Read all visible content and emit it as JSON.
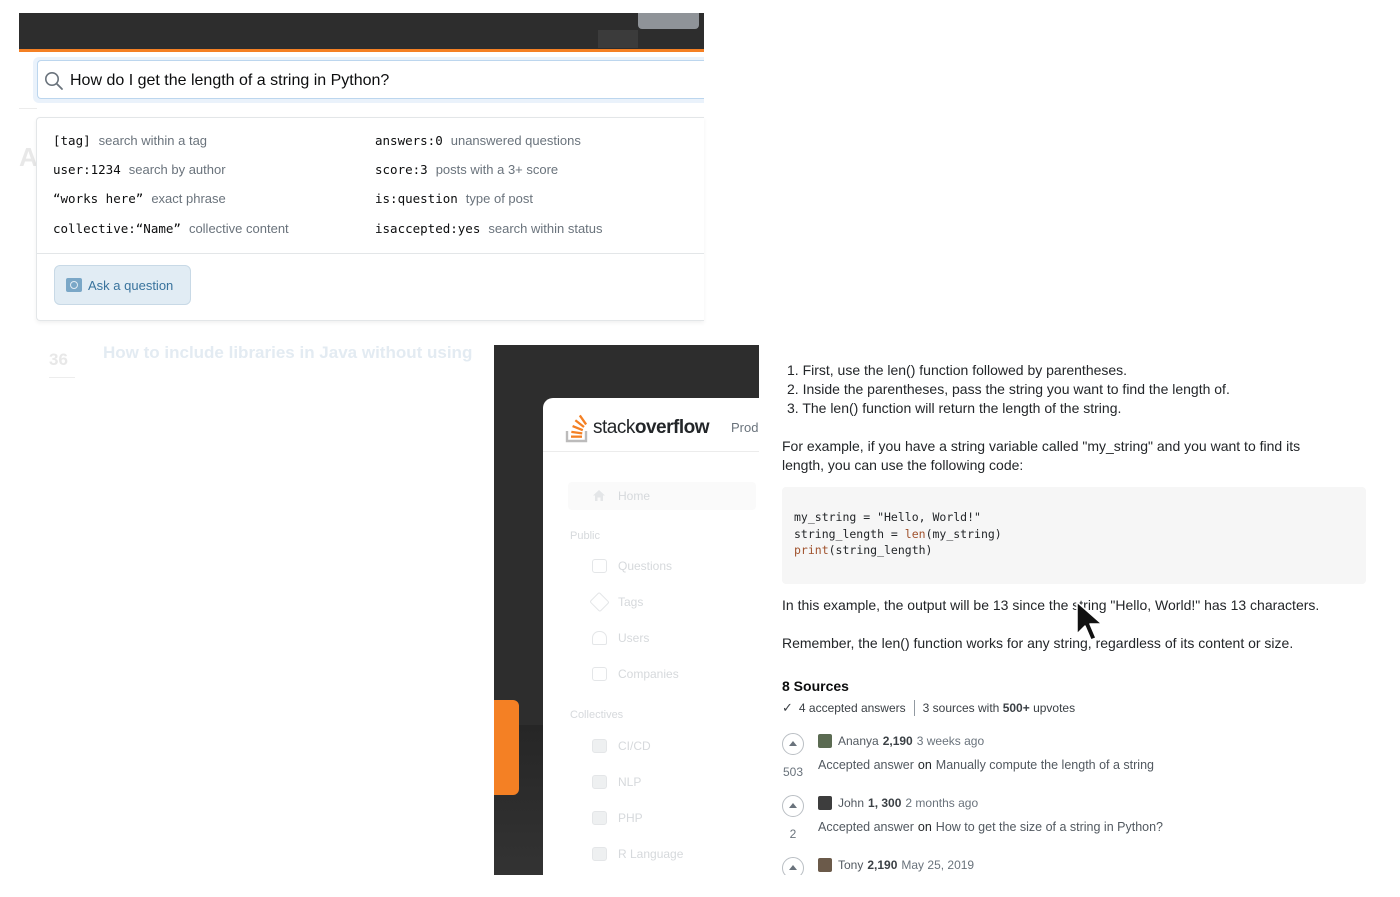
{
  "search": {
    "query": "How do I get the length of a string in Python?",
    "hints_left": [
      {
        "code": "[tag]",
        "desc": "search within a tag"
      },
      {
        "code": "user:1234",
        "desc": "search by author"
      },
      {
        "code": "“works here”",
        "desc": "exact phrase"
      },
      {
        "code": "collective:“Name”",
        "desc": "collective content"
      }
    ],
    "hints_right": [
      {
        "code": "answers:0",
        "desc": "unanswered questions"
      },
      {
        "code": "score:3",
        "desc": "posts with a 3+ score"
      },
      {
        "code": "is:question",
        "desc": "type of post"
      },
      {
        "code": "isaccepted:yes",
        "desc": "search within status"
      }
    ],
    "ask_button": "Ask a question"
  },
  "background": {
    "heading_initial": "A",
    "question_score": "36",
    "question_title": "How to include libraries in Java without using"
  },
  "sidebar": {
    "logo_light": "stack",
    "logo_bold": "overflow",
    "products_label": "Prod",
    "home": "Home",
    "public_label": "Public",
    "items": [
      "Questions",
      "Tags",
      "Users",
      "Companies"
    ],
    "collectives_label": "Collectives",
    "collectives": [
      "CI/CD",
      "NLP",
      "PHP",
      "R Language"
    ]
  },
  "answer": {
    "steps": [
      "1.  First, use the len() function followed by parentheses.",
      "2.  Inside the parentheses, pass the string you want to find the length of.",
      "3.  The len() function will return the length of the string."
    ],
    "example_line1": "For example, if you have a string variable called \"my_string\" and you want to find its",
    "example_line2": "length, you can use the following code:",
    "code_line1": "my_string = \"Hello, World!\"",
    "code_line2_a": "string_length = ",
    "code_line2_kw": "len",
    "code_line2_b": "(my_string)",
    "code_line3_kw": "print",
    "code_line3_b": "(string_length)",
    "output_text": "In this example, the output will be 13 since the string \"Hello, World!\" has 13 characters.",
    "remember_text": "Remember, the len() function works for any string, regardless of its content or size."
  },
  "sources": {
    "title": "8 Sources",
    "accepted": "4 accepted answers",
    "upvotes_prefix": "3 sources with",
    "upvotes_bold": "500+",
    "upvotes_suffix": "upvotes",
    "items": [
      {
        "user": "Ananya",
        "rep": "2,190",
        "when": "3 weeks ago",
        "votes": "503",
        "kind": "Accepted answer",
        "on": "on",
        "title": "Manually compute the length of a string",
        "avatar_color": "#5b6b52"
      },
      {
        "user": "John",
        "rep": "1, 300",
        "when": "2 months ago",
        "votes": "2",
        "kind": "Accepted answer",
        "on": "on",
        "title": "How to get the size of a string in Python?",
        "avatar_color": "#3d3d3d"
      },
      {
        "user": "Tony",
        "rep": "2,190",
        "when": "May 25, 2019",
        "votes": "",
        "kind": "",
        "on": "",
        "title": "",
        "avatar_color": "#6b5a4a"
      }
    ]
  },
  "colors": {
    "brand_orange": "#f48024",
    "topbar_dark": "#2d2d2d",
    "link_blue": "#39739d"
  }
}
